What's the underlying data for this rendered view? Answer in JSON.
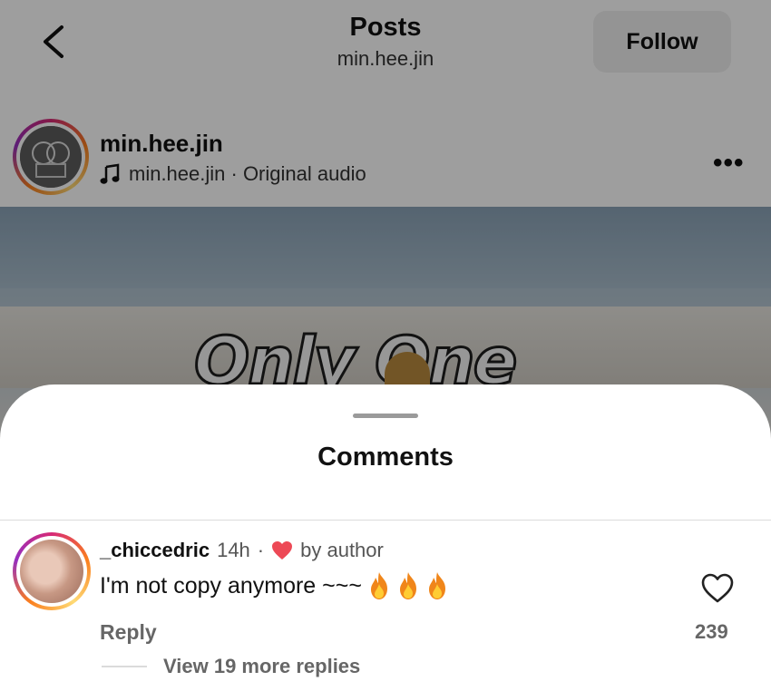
{
  "header": {
    "title": "Posts",
    "subtitle": "min.hee.jin",
    "follow_label": "Follow"
  },
  "post": {
    "username": "min.hee.jin",
    "audio_text": "min.hee.jin · Original audio",
    "media_text": "Only One"
  },
  "comments_sheet": {
    "title": "Comments",
    "comment": {
      "username": "_chiccedric",
      "time": "14h",
      "separator": "·",
      "liked_by": "by author",
      "text": "I'm not copy anymore ~~~",
      "reply_label": "Reply",
      "like_count": "239",
      "view_replies": "View 19 more replies"
    }
  },
  "colors": {
    "heart_red": "#ed4956",
    "ring_gradient": [
      "#d62976",
      "#fa7e1e",
      "#feda75",
      "#962fbf"
    ]
  },
  "icons": [
    "back-chevron-icon",
    "music-note-icon",
    "more-icon",
    "heart-filled-icon",
    "heart-outline-icon",
    "fire-emoji-icon"
  ]
}
